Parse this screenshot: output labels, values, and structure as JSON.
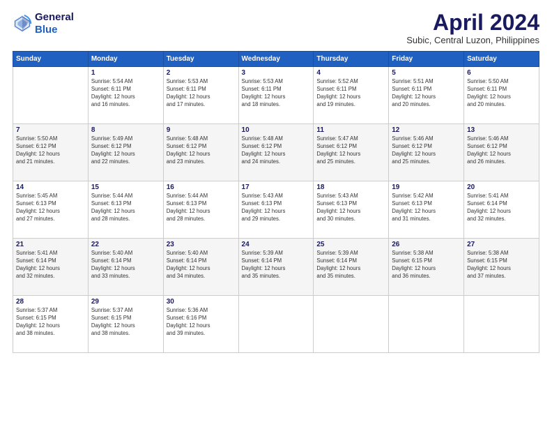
{
  "header": {
    "logo_line1": "General",
    "logo_line2": "Blue",
    "month": "April 2024",
    "location": "Subic, Central Luzon, Philippines"
  },
  "weekdays": [
    "Sunday",
    "Monday",
    "Tuesday",
    "Wednesday",
    "Thursday",
    "Friday",
    "Saturday"
  ],
  "weeks": [
    [
      {
        "day": "",
        "info": ""
      },
      {
        "day": "1",
        "info": "Sunrise: 5:54 AM\nSunset: 6:11 PM\nDaylight: 12 hours\nand 16 minutes."
      },
      {
        "day": "2",
        "info": "Sunrise: 5:53 AM\nSunset: 6:11 PM\nDaylight: 12 hours\nand 17 minutes."
      },
      {
        "day": "3",
        "info": "Sunrise: 5:53 AM\nSunset: 6:11 PM\nDaylight: 12 hours\nand 18 minutes."
      },
      {
        "day": "4",
        "info": "Sunrise: 5:52 AM\nSunset: 6:11 PM\nDaylight: 12 hours\nand 19 minutes."
      },
      {
        "day": "5",
        "info": "Sunrise: 5:51 AM\nSunset: 6:11 PM\nDaylight: 12 hours\nand 20 minutes."
      },
      {
        "day": "6",
        "info": "Sunrise: 5:50 AM\nSunset: 6:11 PM\nDaylight: 12 hours\nand 20 minutes."
      }
    ],
    [
      {
        "day": "7",
        "info": "Sunrise: 5:50 AM\nSunset: 6:12 PM\nDaylight: 12 hours\nand 21 minutes."
      },
      {
        "day": "8",
        "info": "Sunrise: 5:49 AM\nSunset: 6:12 PM\nDaylight: 12 hours\nand 22 minutes."
      },
      {
        "day": "9",
        "info": "Sunrise: 5:48 AM\nSunset: 6:12 PM\nDaylight: 12 hours\nand 23 minutes."
      },
      {
        "day": "10",
        "info": "Sunrise: 5:48 AM\nSunset: 6:12 PM\nDaylight: 12 hours\nand 24 minutes."
      },
      {
        "day": "11",
        "info": "Sunrise: 5:47 AM\nSunset: 6:12 PM\nDaylight: 12 hours\nand 25 minutes."
      },
      {
        "day": "12",
        "info": "Sunrise: 5:46 AM\nSunset: 6:12 PM\nDaylight: 12 hours\nand 25 minutes."
      },
      {
        "day": "13",
        "info": "Sunrise: 5:46 AM\nSunset: 6:12 PM\nDaylight: 12 hours\nand 26 minutes."
      }
    ],
    [
      {
        "day": "14",
        "info": "Sunrise: 5:45 AM\nSunset: 6:13 PM\nDaylight: 12 hours\nand 27 minutes."
      },
      {
        "day": "15",
        "info": "Sunrise: 5:44 AM\nSunset: 6:13 PM\nDaylight: 12 hours\nand 28 minutes."
      },
      {
        "day": "16",
        "info": "Sunrise: 5:44 AM\nSunset: 6:13 PM\nDaylight: 12 hours\nand 28 minutes."
      },
      {
        "day": "17",
        "info": "Sunrise: 5:43 AM\nSunset: 6:13 PM\nDaylight: 12 hours\nand 29 minutes."
      },
      {
        "day": "18",
        "info": "Sunrise: 5:43 AM\nSunset: 6:13 PM\nDaylight: 12 hours\nand 30 minutes."
      },
      {
        "day": "19",
        "info": "Sunrise: 5:42 AM\nSunset: 6:13 PM\nDaylight: 12 hours\nand 31 minutes."
      },
      {
        "day": "20",
        "info": "Sunrise: 5:41 AM\nSunset: 6:14 PM\nDaylight: 12 hours\nand 32 minutes."
      }
    ],
    [
      {
        "day": "21",
        "info": "Sunrise: 5:41 AM\nSunset: 6:14 PM\nDaylight: 12 hours\nand 32 minutes."
      },
      {
        "day": "22",
        "info": "Sunrise: 5:40 AM\nSunset: 6:14 PM\nDaylight: 12 hours\nand 33 minutes."
      },
      {
        "day": "23",
        "info": "Sunrise: 5:40 AM\nSunset: 6:14 PM\nDaylight: 12 hours\nand 34 minutes."
      },
      {
        "day": "24",
        "info": "Sunrise: 5:39 AM\nSunset: 6:14 PM\nDaylight: 12 hours\nand 35 minutes."
      },
      {
        "day": "25",
        "info": "Sunrise: 5:39 AM\nSunset: 6:14 PM\nDaylight: 12 hours\nand 35 minutes."
      },
      {
        "day": "26",
        "info": "Sunrise: 5:38 AM\nSunset: 6:15 PM\nDaylight: 12 hours\nand 36 minutes."
      },
      {
        "day": "27",
        "info": "Sunrise: 5:38 AM\nSunset: 6:15 PM\nDaylight: 12 hours\nand 37 minutes."
      }
    ],
    [
      {
        "day": "28",
        "info": "Sunrise: 5:37 AM\nSunset: 6:15 PM\nDaylight: 12 hours\nand 38 minutes."
      },
      {
        "day": "29",
        "info": "Sunrise: 5:37 AM\nSunset: 6:15 PM\nDaylight: 12 hours\nand 38 minutes."
      },
      {
        "day": "30",
        "info": "Sunrise: 5:36 AM\nSunset: 6:16 PM\nDaylight: 12 hours\nand 39 minutes."
      },
      {
        "day": "",
        "info": ""
      },
      {
        "day": "",
        "info": ""
      },
      {
        "day": "",
        "info": ""
      },
      {
        "day": "",
        "info": ""
      }
    ]
  ]
}
